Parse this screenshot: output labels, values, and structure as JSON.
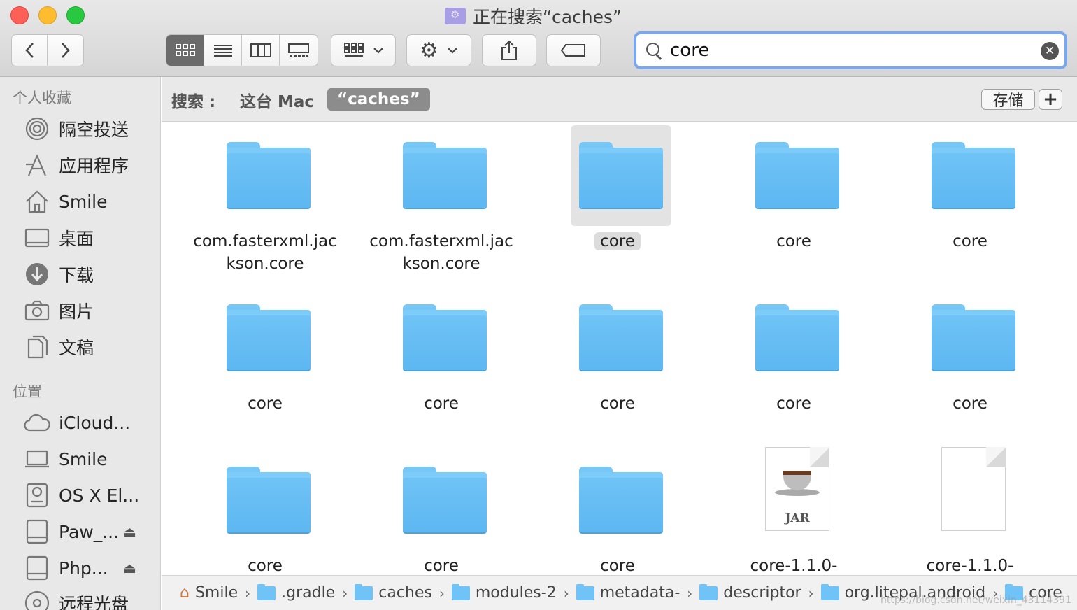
{
  "window": {
    "title": "正在搜索“caches”"
  },
  "search": {
    "value": "core"
  },
  "sidebar": {
    "favorites_header": "个人收藏",
    "favorites": [
      {
        "label": "隔空投送",
        "icon": "airdrop-icon"
      },
      {
        "label": "应用程序",
        "icon": "applications-icon"
      },
      {
        "label": "Smile",
        "icon": "home-icon"
      },
      {
        "label": "桌面",
        "icon": "desktop-icon"
      },
      {
        "label": "下载",
        "icon": "download-icon"
      },
      {
        "label": "图片",
        "icon": "camera-icon"
      },
      {
        "label": "文稿",
        "icon": "documents-icon"
      }
    ],
    "locations_header": "位置",
    "locations": [
      {
        "label": "iCloud...",
        "icon": "cloud-icon"
      },
      {
        "label": "Smile",
        "icon": "laptop-icon"
      },
      {
        "label": "OS X El...",
        "icon": "disk-icon"
      },
      {
        "label": "Paw_...",
        "icon": "drive-icon",
        "eject": true
      },
      {
        "label": "Php...",
        "icon": "drive-icon",
        "eject": true
      },
      {
        "label": "远程光盘",
        "icon": "optical-disc-icon"
      }
    ]
  },
  "scope": {
    "label": "搜索 :",
    "this_mac": "这台 Mac",
    "selected": "“caches”",
    "save_label": "存储",
    "add_label": "+"
  },
  "files": [
    {
      "name": "com.fasterxml.jackson.core",
      "line1": "com.fasterxml.jac",
      "line2": "kson.core",
      "kind": "folder"
    },
    {
      "name": "com.fasterxml.jackson.core",
      "line1": "com.fasterxml.jac",
      "line2": "kson.core",
      "kind": "folder"
    },
    {
      "name": "core",
      "line1": "core",
      "line2": "",
      "kind": "folder",
      "selected": true
    },
    {
      "name": "core",
      "line1": "core",
      "line2": "",
      "kind": "folder"
    },
    {
      "name": "core",
      "line1": "core",
      "line2": "",
      "kind": "folder"
    },
    {
      "name": "core",
      "line1": "core",
      "line2": "",
      "kind": "folder"
    },
    {
      "name": "core",
      "line1": "core",
      "line2": "",
      "kind": "folder"
    },
    {
      "name": "core",
      "line1": "core",
      "line2": "",
      "kind": "folder"
    },
    {
      "name": "core",
      "line1": "core",
      "line2": "",
      "kind": "folder"
    },
    {
      "name": "core",
      "line1": "core",
      "line2": "",
      "kind": "folder"
    },
    {
      "name": "core",
      "line1": "core",
      "line2": "",
      "kind": "folder"
    },
    {
      "name": "core",
      "line1": "core",
      "line2": "",
      "kind": "folder"
    },
    {
      "name": "core",
      "line1": "core",
      "line2": "",
      "kind": "folder"
    },
    {
      "name": "core-1.1.0-",
      "line1": "core-1.1.0-",
      "line2": "",
      "kind": "jar",
      "badge": "JAR"
    },
    {
      "name": "core-1.1.0-",
      "line1": "core-1.1.0-",
      "line2": "",
      "kind": "document"
    }
  ],
  "path": [
    "Smile",
    ".gradle",
    "caches",
    "modules-2",
    "metadata-",
    "descriptor",
    "org.litepal.android",
    "core"
  ],
  "watermark": "https://blog.csdn.net/weixin_43114391"
}
